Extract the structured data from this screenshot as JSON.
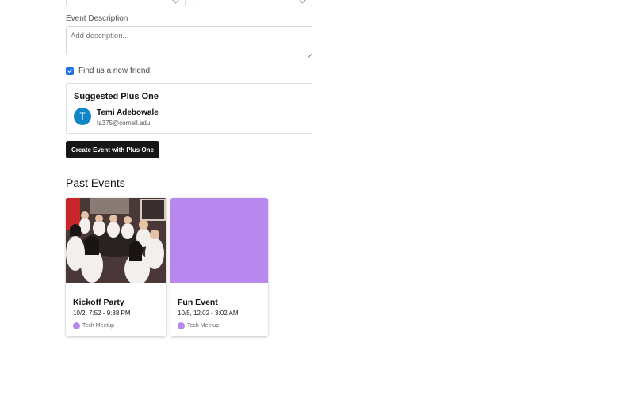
{
  "form": {
    "description_label": "Event Description",
    "description_placeholder": "Add description...",
    "find_friend_label": "Find us a new friend!",
    "find_friend_checked": true
  },
  "suggested_plus_one": {
    "title": "Suggested Plus One",
    "avatar_initial": "T",
    "avatar_color": "#0f86c8",
    "name": "Temi Adebowale",
    "email": "ta375@cornell.edu"
  },
  "create_button_label": "Create Event with Plus One",
  "past_events": {
    "title": "Past Events",
    "items": [
      {
        "name": "Kickoff Party",
        "time": "10/2, 7:52 - 9:38 PM",
        "tag": "Tech Meetup",
        "tag_color": "#b988ee",
        "image": "group-photo"
      },
      {
        "name": "Fun Event",
        "time": "10/5, 12:02 - 3:02 AM",
        "tag": "Tech Meetup",
        "tag_color": "#b988ee",
        "image_color": "#b988ee"
      }
    ]
  },
  "colors": {
    "button_bg": "#161616",
    "checkbox": "#1a73e8",
    "accent_purple": "#b988ee"
  }
}
